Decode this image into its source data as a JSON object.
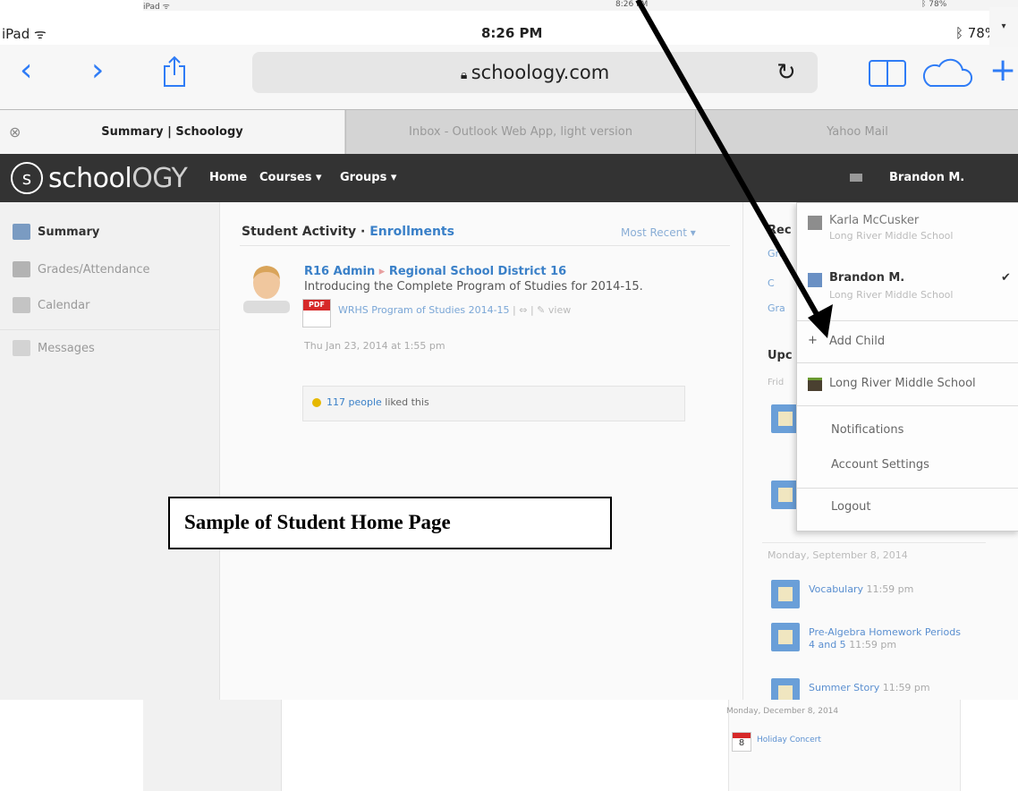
{
  "back_status": {
    "device": "iPad ᯤ",
    "time": "8:26 PM",
    "battery": "ᛒ 78%"
  },
  "status_bar": {
    "device": "iPad ᯤ",
    "time": "8:26 PM",
    "battery": "ᛒ 78%"
  },
  "browser": {
    "url": "schoology.com",
    "nav_icons": [
      "back-icon",
      "forward-icon",
      "share-icon",
      "reload-icon",
      "bookmarks-icon",
      "cloud-icon",
      "add-tab-icon"
    ],
    "accent": "#2f7cf6"
  },
  "tabs": [
    {
      "label": "Summary | Schoology",
      "active": true
    },
    {
      "label": "Inbox - Outlook Web App, light version",
      "active": false
    },
    {
      "label": "Yahoo Mail",
      "active": false
    }
  ],
  "header": {
    "logo_prefix": "school",
    "logo_suffix": "OGY",
    "nav": [
      "Home",
      "Courses ▾",
      "Groups ▾"
    ],
    "user_name": "Brandon M.",
    "toggle": "▾",
    "background": "#333333"
  },
  "sidebar": {
    "items": [
      {
        "label": "Summary",
        "icon": "summary-icon",
        "active": true
      },
      {
        "label": "Grades/Attendance",
        "icon": "grades-icon",
        "active": false
      },
      {
        "label": "Calendar",
        "icon": "calendar-icon",
        "active": false
      },
      {
        "label": "Messages",
        "icon": "messages-icon",
        "active": false
      }
    ]
  },
  "activity": {
    "title": "Student Activity · ",
    "title_link": "Enrollments",
    "sort": "Most Recent ▾",
    "post": {
      "author": "R16 Admin",
      "arrow": "▸",
      "group": "Regional School District 16",
      "body": "Introducing the Complete Program of Studies for 2014-15.",
      "attachment": "WRHS Program of Studies 2014-15",
      "attachment_actions": " | ⇔ | ✎ view",
      "pdf_label": "PDF",
      "date": "Thu Jan 23, 2014 at 1:55 pm",
      "likes_link": "117 people",
      "likes_text": " liked this"
    }
  },
  "right_column": {
    "recent_head": "Rec",
    "recent_links": [
      "Gra",
      "C",
      "Gra"
    ],
    "upcoming_head": "Upc",
    "upcoming_sub": "Frid",
    "day1": "Monday, September 8, 2014",
    "tasks": [
      {
        "title": "Vocabulary",
        "time": "11:59 pm"
      },
      {
        "title": "Pre-Algebra Homework Periods 4 and 5",
        "time": "11:59 pm"
      },
      {
        "title": "Summer Story",
        "time": "11:59 pm"
      }
    ],
    "day2": "Monday, December 8, 2014",
    "event": {
      "title": "Holiday Concert",
      "date_num": "8"
    }
  },
  "dropdown": {
    "accounts": [
      {
        "name": "Karla McCusker",
        "school": "Long River Middle School",
        "selected": false
      },
      {
        "name": "Brandon M.",
        "school": "Long River Middle School",
        "selected": true
      }
    ],
    "check": "✔",
    "add_child": "Add Child",
    "school": "Long River Middle School",
    "notifications": "Notifications",
    "account_settings": "Account Settings",
    "logout": "Logout"
  },
  "annotation": {
    "caption": "Sample of Student Home Page"
  }
}
